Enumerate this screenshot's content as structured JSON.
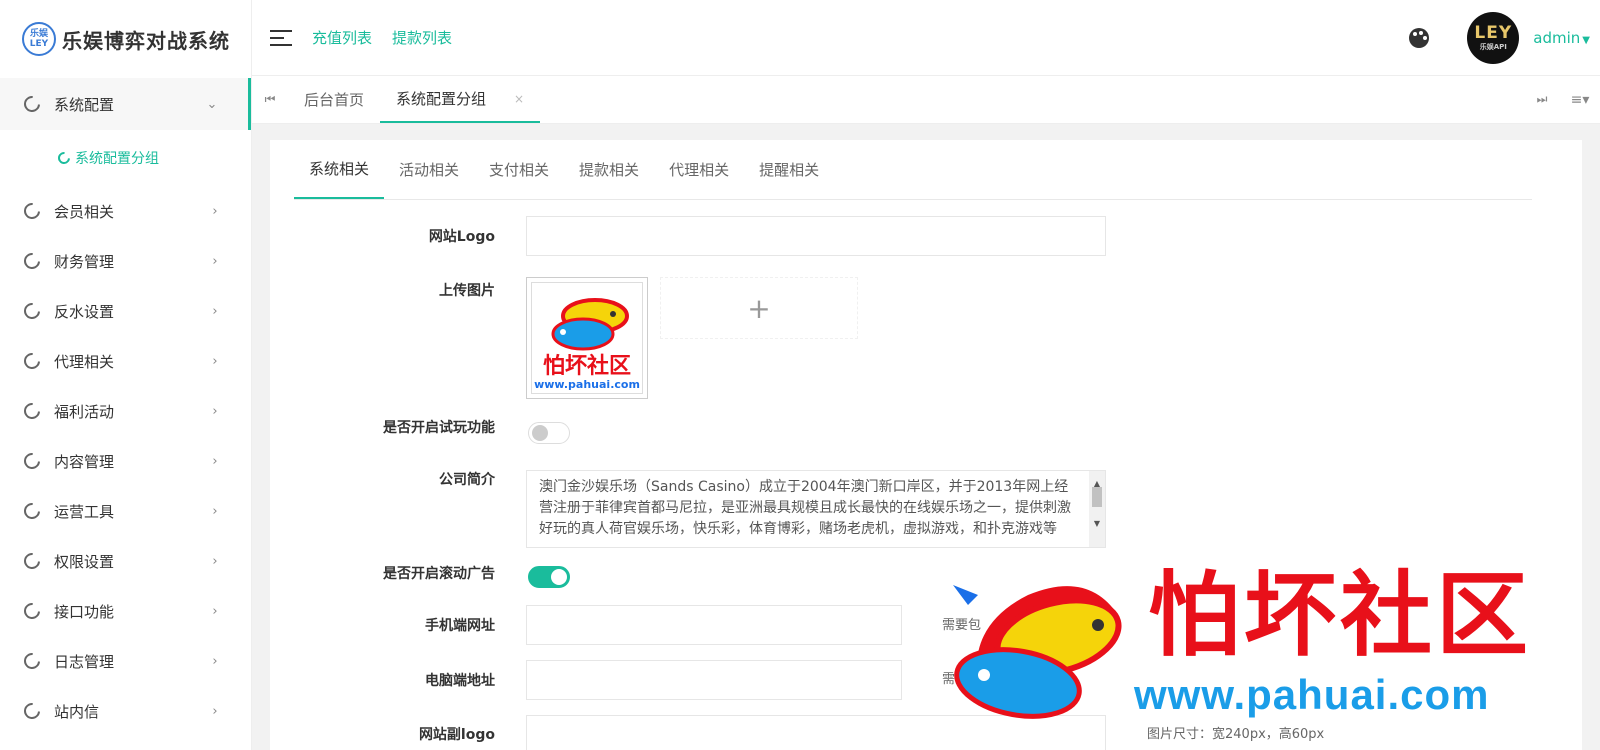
{
  "brand": {
    "logo_text_top": "乐娱",
    "logo_text_bottom": "LEY",
    "title": "乐娱博弈对战系统"
  },
  "sidebar": {
    "items": [
      {
        "label": "系统配置",
        "arrow": "⌄",
        "active": true
      },
      {
        "label": "会员相关",
        "arrow": "›"
      },
      {
        "label": "财务管理",
        "arrow": "›"
      },
      {
        "label": "反水设置",
        "arrow": "›"
      },
      {
        "label": "代理相关",
        "arrow": "›"
      },
      {
        "label": "福利活动",
        "arrow": "›"
      },
      {
        "label": "内容管理",
        "arrow": "›"
      },
      {
        "label": "运营工具",
        "arrow": "›"
      },
      {
        "label": "权限设置",
        "arrow": "›"
      },
      {
        "label": "接口功能",
        "arrow": "›"
      },
      {
        "label": "日志管理",
        "arrow": "›"
      },
      {
        "label": "站内信",
        "arrow": "›"
      }
    ],
    "subitem": "系统配置分组"
  },
  "header": {
    "links": [
      "充值列表",
      "提款列表"
    ],
    "avatar_big": "LEY",
    "avatar_small": "乐娱API",
    "user": "admin"
  },
  "tabbar": {
    "prev": "⏮",
    "next": "⏭",
    "menu": "≡▾",
    "tabs": [
      {
        "label": "后台首页"
      },
      {
        "label": "系统配置分组",
        "close": "×"
      }
    ]
  },
  "form": {
    "tabs": [
      "系统相关",
      "活动相关",
      "支付相关",
      "提款相关",
      "代理相关",
      "提醒相关"
    ],
    "labels": {
      "logo": "网站Logo",
      "upload": "上传图片",
      "trial": "是否开启试玩功能",
      "intro": "公司简介",
      "scroll_ad": "是否开启滚动广告",
      "mobile_url": "手机端网址",
      "pc_url": "电脑端地址",
      "sub_logo": "网站副logo"
    },
    "upload_add": "+",
    "thumb_title": "怕坏社区",
    "thumb_url": "www.pahuai.com",
    "intro_text": "澳门金沙娱乐场（Sands Casino）成立于2004年澳门新口岸区，并于2013年网上经营注册于菲律宾首都马尼拉，是亚洲最具规模且成长最快的在线娱乐场之一，提供刺激好玩的真人荷官娱乐场，快乐彩，体育博彩，赌场老虎机，虚拟游戏，和扑克游戏等",
    "trial_enabled": false,
    "scroll_ad_enabled": true,
    "mobile_hint": "需要包",
    "pc_hint": "需要",
    "image_size_hint": "图片尺寸：宽240px，高60px"
  },
  "watermark": {
    "title": "怕坏社区",
    "url": "www.pahuai.com"
  },
  "colors": {
    "accent": "#1abc9c",
    "watermark_red": "#e8101a",
    "watermark_blue": "#1a9de8"
  }
}
